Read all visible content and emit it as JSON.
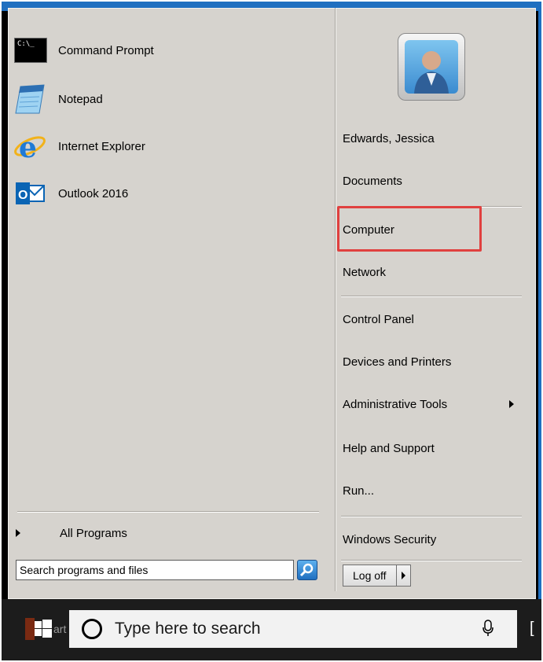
{
  "programs": [
    {
      "label": "Command Prompt",
      "icon": "command-prompt-icon"
    },
    {
      "label": "Notepad",
      "icon": "notepad-icon"
    },
    {
      "label": "Internet Explorer",
      "icon": "internet-explorer-icon"
    },
    {
      "label": "Outlook 2016",
      "icon": "outlook-icon"
    }
  ],
  "cmd_icon_text": "C:\\_",
  "all_programs": "All Programs",
  "search": {
    "placeholder": "Search programs and files",
    "value": ""
  },
  "right_items": [
    {
      "label": "Edwards, Jessica"
    },
    {
      "label": "Documents"
    },
    {
      "label": "Computer"
    },
    {
      "label": "Network"
    },
    {
      "label": "Control Panel"
    },
    {
      "label": "Devices and Printers"
    },
    {
      "label": "Administrative Tools"
    },
    {
      "label": "Help and Support"
    },
    {
      "label": "Run..."
    },
    {
      "label": "Windows Security"
    }
  ],
  "logoff_label": "Log off",
  "taskbar": {
    "search_text": "Type here to search",
    "start_partial_text": "art"
  },
  "colors": {
    "highlight": "#e0403f",
    "menu_bg": "#d6d3ce",
    "taskbar": "#1c1c1c",
    "accent": "#1f6fc0"
  }
}
